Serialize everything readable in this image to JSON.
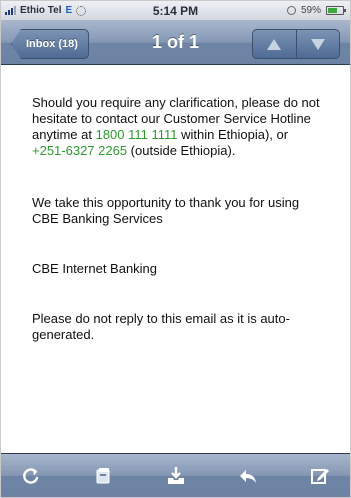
{
  "status_bar": {
    "carrier": "Ethio Tel",
    "network": "E",
    "time": "5:14 PM",
    "battery": "59%",
    "battery_level": 0.59
  },
  "nav": {
    "back_label": "Inbox (18)",
    "title": "1 of 1"
  },
  "message": {
    "p1_before": "Should you require any clarification, please do not hesitate to contact our Customer Service Hotline anytime at ",
    "hotline": "1800 111 1111",
    "p1_middle": " within Ethiopia), or ",
    "intl_number": "+251-6327 2265",
    "p1_after": " (outside Ethiopia).",
    "p2": "We take this opportunity to thank you for using CBE Banking Services",
    "p3": "CBE Internet Banking",
    "p4": "Please do not reply to this email as it is auto-generated."
  },
  "toolbar": {
    "icons": [
      "refresh-icon",
      "folder-icon",
      "move-icon",
      "reply-icon",
      "compose-icon"
    ]
  },
  "colors": {
    "link_green": "#2e9a2e",
    "bar_blue": "#6e84a4"
  }
}
